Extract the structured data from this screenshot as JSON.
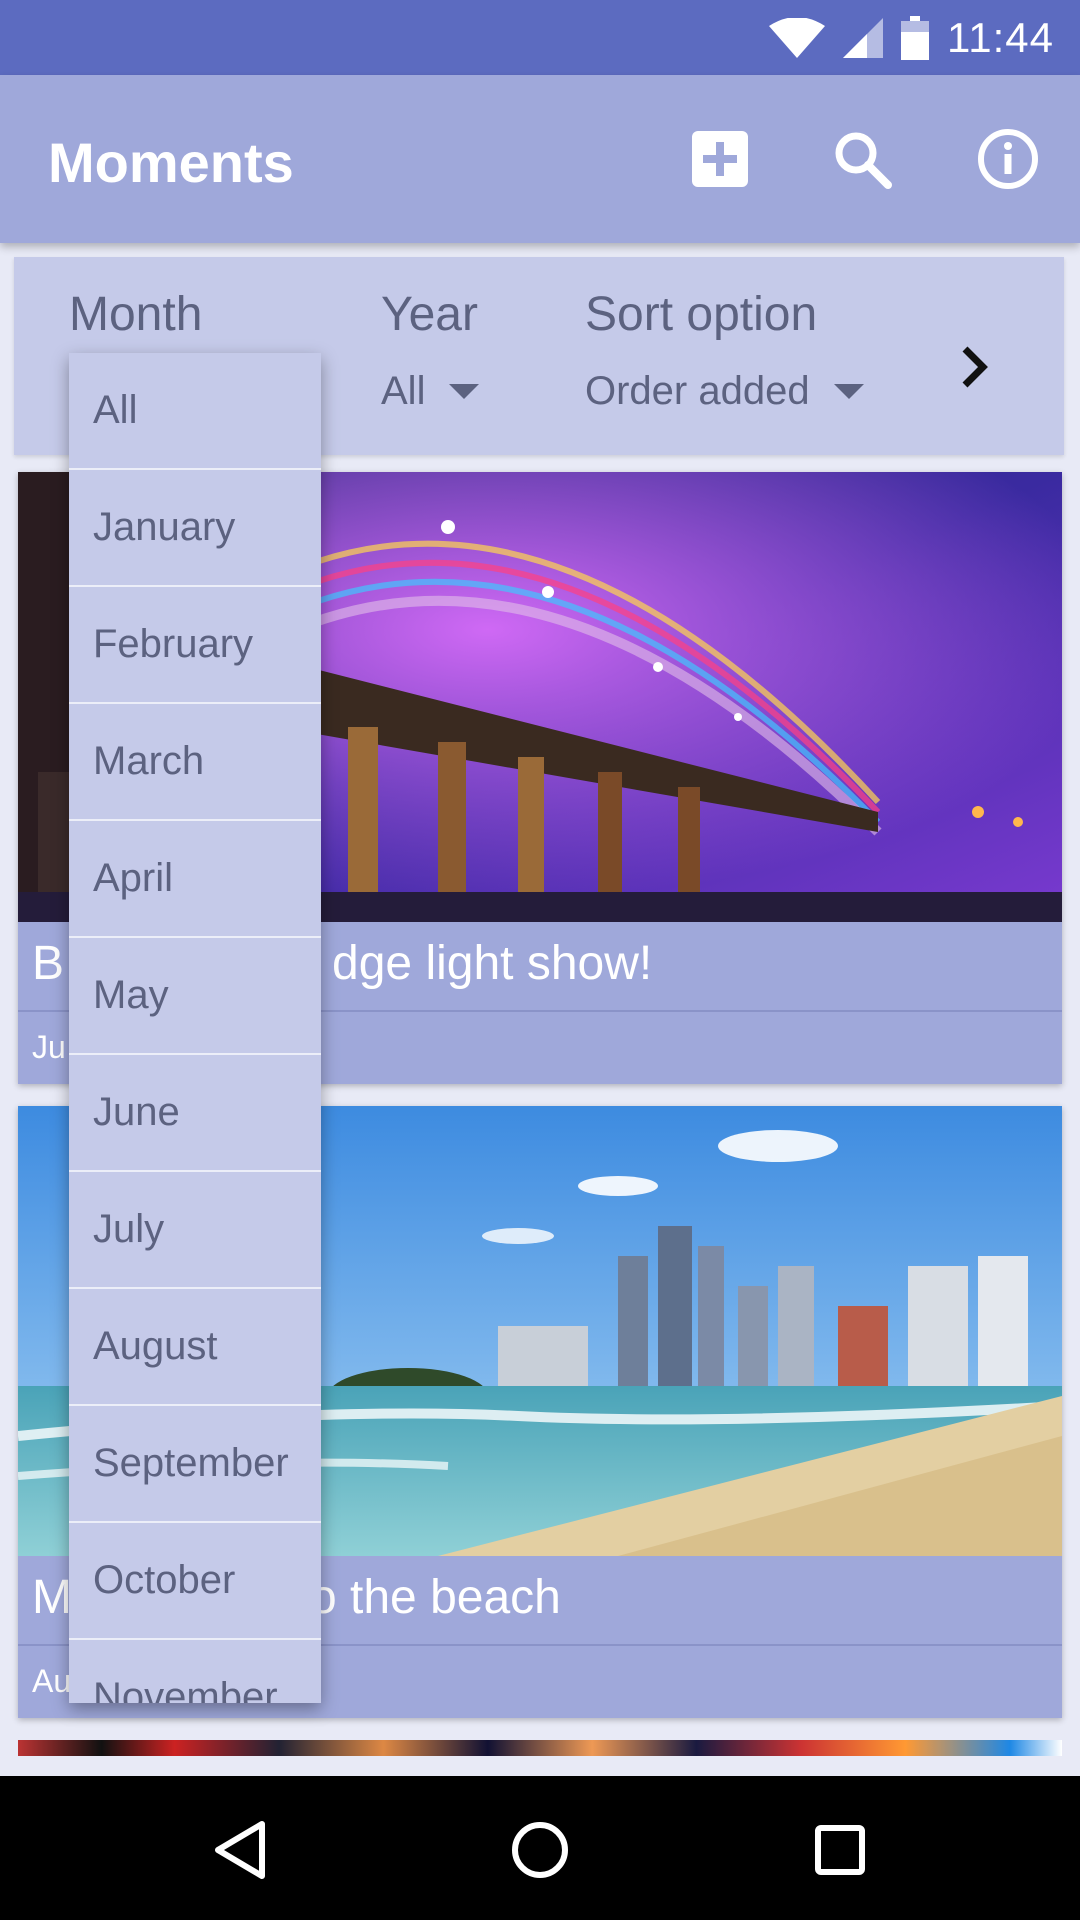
{
  "status_bar": {
    "time": "11:44",
    "icons": [
      "wifi-icon",
      "signal-icon",
      "battery-icon"
    ]
  },
  "app_bar": {
    "title": "Moments",
    "actions": [
      "add-box-icon",
      "search-icon",
      "info-icon"
    ]
  },
  "filters": {
    "month": {
      "label": "Month"
    },
    "year": {
      "label": "Year",
      "value": "All"
    },
    "sort": {
      "label": "Sort option",
      "value": "Order added"
    },
    "next_icon": "chevron-right-icon"
  },
  "month_dropdown": {
    "options": [
      "All",
      "January",
      "February",
      "March",
      "April",
      "May",
      "June",
      "July",
      "August",
      "September",
      "October",
      "November"
    ]
  },
  "cards": [
    {
      "title_visible": "dge light show!",
      "title_prefix": "B",
      "date_prefix": "Ju"
    },
    {
      "title_visible": "o the beach",
      "title_prefix": "M",
      "date_prefix": "Au"
    }
  ],
  "colors": {
    "status_bar": "#5C6BC0",
    "app_bar": "#9FA8DA",
    "panel": "#C5CAE9",
    "text_muted": "#5C6280",
    "background": "#E8EAF6"
  },
  "nav_bar": {
    "buttons": [
      "back-icon",
      "home-icon",
      "recents-icon"
    ]
  }
}
